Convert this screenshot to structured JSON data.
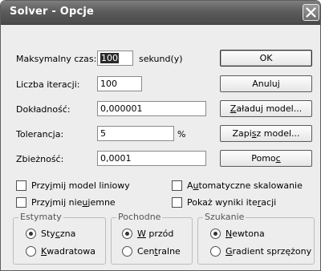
{
  "window": {
    "title": "Solver - Opcje"
  },
  "fields": {
    "max_time": {
      "label_pre": "Maksymalny czas",
      "label_post": ":",
      "value": "100",
      "unit": "sekund(y)"
    },
    "iterations": {
      "label": "Liczba iteracji:",
      "value": "100"
    },
    "precision": {
      "label": "Dokładność:",
      "value": "0,000001"
    },
    "tolerance": {
      "label": "Tolerancja:",
      "value": "5",
      "unit": "%"
    },
    "convergence": {
      "label": "Zbieżność:",
      "value": "0,0001"
    }
  },
  "buttons": {
    "ok": "OK",
    "cancel": "Anuluj",
    "load_model": {
      "pre": "",
      "u": "Z",
      "post": "aładuj model..."
    },
    "save_model": {
      "pre": "Zapi",
      "u": "s",
      "post": "z model..."
    },
    "help": {
      "pre": "Pomo",
      "u": "c",
      "post": ""
    }
  },
  "checkboxes": {
    "linear_model": {
      "pre": "Przy",
      "u": "j",
      "post": "mij model liniowy",
      "checked": false
    },
    "auto_scaling": {
      "pre": "A",
      "u": "u",
      "post": "tomatyczne skalowanie",
      "checked": false
    },
    "non_negative": {
      "pre": "Przyjmij nie",
      "u": "u",
      "post": "jemne",
      "checked": false
    },
    "show_iterations": {
      "pre": "Pokaż wyniki ite",
      "u": "r",
      "post": "acji",
      "checked": false
    }
  },
  "groups": {
    "estimates": {
      "title": "Estymaty",
      "options": [
        {
          "pre": "Sty",
          "u": "c",
          "post": "zna",
          "selected": true
        },
        {
          "pre": "",
          "u": "K",
          "post": "wadratowa",
          "selected": false
        }
      ]
    },
    "derivatives": {
      "title": "Pochodne",
      "options": [
        {
          "pre": "",
          "u": "W",
          "post": " przód",
          "selected": true
        },
        {
          "pre": "Cen",
          "u": "t",
          "post": "ralne",
          "selected": false
        }
      ]
    },
    "search": {
      "title": "Szukanie",
      "options": [
        {
          "pre": "",
          "u": "N",
          "post": "ewtona",
          "selected": true
        },
        {
          "pre": "",
          "u": "G",
          "post": "radient sprzężony",
          "selected": false
        }
      ]
    }
  }
}
